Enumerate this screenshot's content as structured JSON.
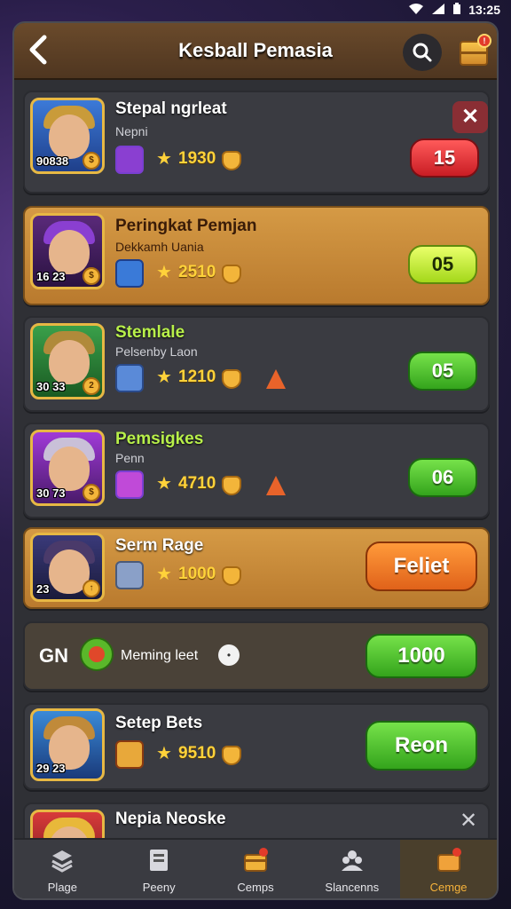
{
  "status": {
    "time": "13:25"
  },
  "header": {
    "title": "Kesball Pemasia",
    "chest_badge": "!"
  },
  "rows": [
    {
      "name": "Stepal ngrleat",
      "sub": "Nepni",
      "score": "90838",
      "value": "1930",
      "button": "15"
    },
    {
      "name": "Peringkat Pemjan",
      "sub": "Dekkamh Uania",
      "score": "16 23",
      "value": "2510",
      "button": "05"
    },
    {
      "name": "Stemlale",
      "sub": "Pelsenby Laon",
      "score": "30 33",
      "value": "1210",
      "button": "05"
    },
    {
      "name": "Pemsigkes",
      "sub": "Penn",
      "score": "30 73",
      "value": "4710",
      "button": "06"
    },
    {
      "name": "Serm Rage",
      "sub": "",
      "score": "23",
      "value": "1000",
      "button": "Feliet"
    },
    {
      "prefix": "GN",
      "name": "Meming leet",
      "button": "1000"
    },
    {
      "name": "Setep Bets",
      "sub": "",
      "score": "29 23",
      "value": "9510",
      "button": "Reon"
    },
    {
      "name": "Nepia Neoske"
    }
  ],
  "tabs": [
    {
      "label": "Plage"
    },
    {
      "label": "Peeny"
    },
    {
      "label": "Cemps"
    },
    {
      "label": "Slancenns"
    },
    {
      "label": "Cemge"
    }
  ],
  "colors": {
    "accent_gold": "#d59a45",
    "button_green": "#34a41c",
    "button_red": "#c91d24"
  }
}
